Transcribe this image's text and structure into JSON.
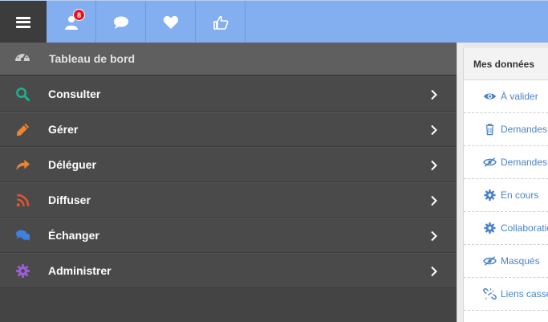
{
  "topbar": {
    "menu_icon": "hamburger-icon",
    "icons": [
      {
        "name": "user-icon",
        "badge": "8"
      },
      {
        "name": "comment-icon"
      },
      {
        "name": "heart-icon"
      },
      {
        "name": "thumbs-up-icon"
      }
    ]
  },
  "sidebar": {
    "dashboard": {
      "label": "Tableau de bord",
      "icon": "dashboard-gauge-icon"
    },
    "items": [
      {
        "label": "Consulter",
        "icon": "search-icon",
        "color": "#1ab394"
      },
      {
        "label": "Gérer",
        "icon": "pencil-icon",
        "color": "#f0852d"
      },
      {
        "label": "Déléguer",
        "icon": "share-arrow-icon",
        "color": "#f0852d"
      },
      {
        "label": "Diffuser",
        "icon": "rss-icon",
        "color": "#e8552d"
      },
      {
        "label": "Échanger",
        "icon": "chat-bubbles-icon",
        "color": "#3f7fe0"
      },
      {
        "label": "Administrer",
        "icon": "gear-icon",
        "color": "#9c5ed6"
      }
    ]
  },
  "panel": {
    "title": "Mes données",
    "items": [
      {
        "label": "À valider",
        "icon": "eye-icon"
      },
      {
        "label": "Demandes",
        "icon": "trash-icon"
      },
      {
        "label": "Demandes",
        "icon": "eye-slash-icon"
      },
      {
        "label": "En cours",
        "icon": "cog-icon"
      },
      {
        "label": "Collaboratio",
        "icon": "cog-icon"
      },
      {
        "label": "Masqués",
        "icon": "eye-slash-icon"
      },
      {
        "label": "Liens cassé",
        "icon": "broken-link-icon"
      }
    ]
  }
}
